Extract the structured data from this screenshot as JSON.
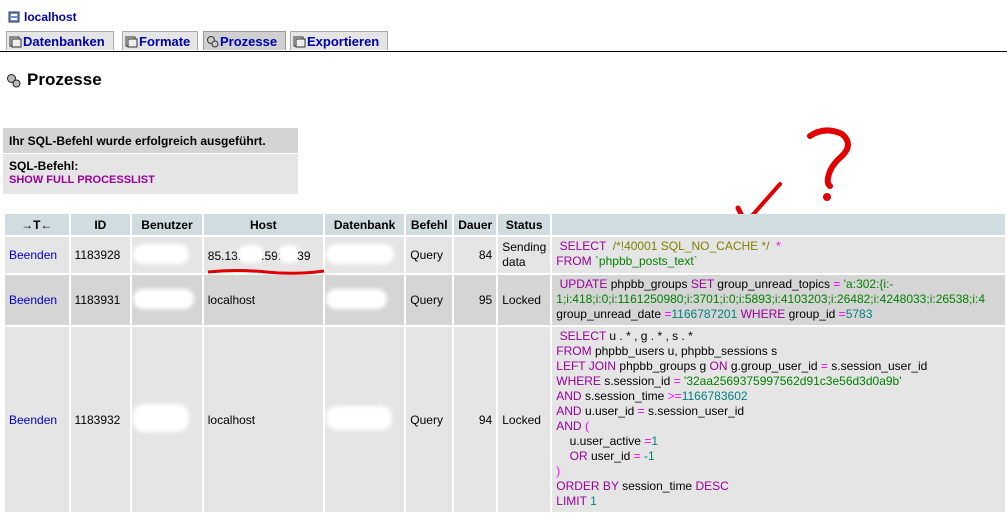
{
  "server": "localhost",
  "tabs": [
    {
      "label": "Datenbanken",
      "active": false
    },
    {
      "label": "Formate",
      "active": false
    },
    {
      "label": "Prozesse",
      "active": true
    },
    {
      "label": "Exportieren",
      "active": false
    }
  ],
  "page_title": "Prozesse",
  "notice": "Ihr SQL-Befehl wurde erfolgreich ausgeführt.",
  "sql_label": "SQL-Befehl:",
  "sql_query": "SHOW FULL PROCESSLIST",
  "table": {
    "sort_icon": "→T←",
    "headers": [
      "ID",
      "Benutzer",
      "Host",
      "Datenbank",
      "Befehl",
      "Dauer",
      "Status"
    ],
    "rows": [
      {
        "action": "Beenden",
        "id": "1183928",
        "host_a": "85.13.",
        "host_b": ".59:",
        "host_c": "39",
        "befehl": "Query",
        "dauer": "84",
        "status": "Sending data"
      },
      {
        "action": "Beenden",
        "id": "1183931",
        "host": "localhost",
        "befehl": "Query",
        "dauer": "95",
        "status": "Locked"
      },
      {
        "action": "Beenden",
        "id": "1183932",
        "host": "localhost",
        "befehl": "Query",
        "dauer": "94",
        "status": "Locked"
      }
    ]
  },
  "sql1": {
    "kw1": "SELECT",
    "comment": "/*!40001 SQL_NO_CACHE */",
    "star": "*",
    "kw2": "FROM",
    "table": "`phpbb_posts_text`"
  },
  "sql2": {
    "kw1": "UPDATE",
    "t": "phpbb_groups",
    "kw2": "SET",
    "col1": "group_unread_topics",
    "eq": "=",
    "val1": "'a:302:{i:-1;i:418;i:0;i:1161250980;i:3701;i:0;i:5893;i:4103203;i:26482;i:4248033;i:26538;i:4",
    "col2": "group_unread_date",
    "val2": "1166787201",
    "kw3": "WHERE",
    "col3": "group_id",
    "val3": "5783"
  },
  "sql3": {
    "l1": "u . * , g . * , s . *",
    "l2_kw": "FROM",
    "l2": "phpbb_users u, phpbb_sessions s",
    "l3_kw": "LEFT JOIN",
    "l3a": "phpbb_groups g",
    "l3_on": "ON",
    "l3b": "g.group_user_id",
    "l3c": "s.session_user_id",
    "l4_kw": "WHERE",
    "l4a": "s.session_id",
    "l4b": "'32aa2569375997562d91c3e56d3d0a9b'",
    "l5_kw": "AND",
    "l5a": "s.session_time",
    "l5op": ">=",
    "l5b": "1166783602",
    "l6_kw": "AND",
    "l6a": "u.user_id",
    "l6b": "s.session_user_id",
    "l7_kw": "AND",
    "l7p": "(",
    "l8a": "u.user_active",
    "l8b": "1",
    "l9_kw": "OR",
    "l9a": "user_id",
    "l9b": "-1",
    "l10": ")",
    "l11_kw": "ORDER BY",
    "l11a": "session_time",
    "l11b": "DESC",
    "l12_kw": "LIMIT",
    "l12a": "1"
  },
  "annotation_icon": "question-mark-arrow-annotation"
}
